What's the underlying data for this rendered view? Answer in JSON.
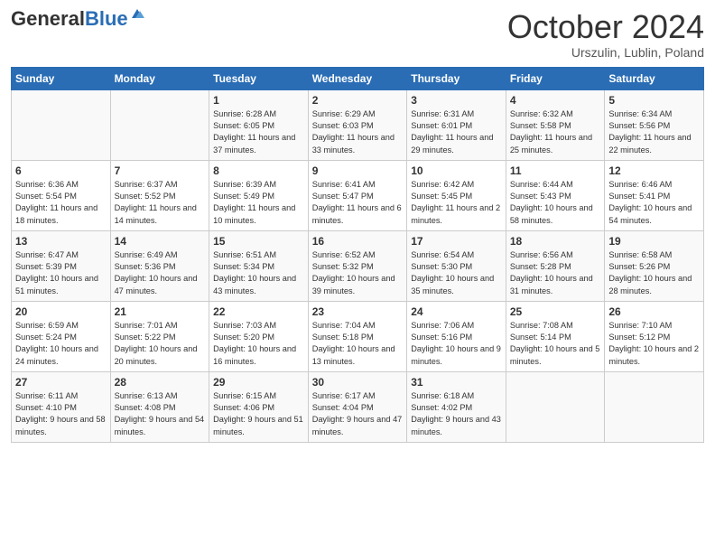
{
  "header": {
    "logo_general": "General",
    "logo_blue": "Blue",
    "month": "October 2024",
    "location": "Urszulin, Lublin, Poland"
  },
  "days_of_week": [
    "Sunday",
    "Monday",
    "Tuesday",
    "Wednesday",
    "Thursday",
    "Friday",
    "Saturday"
  ],
  "weeks": [
    [
      {
        "day": "",
        "info": ""
      },
      {
        "day": "",
        "info": ""
      },
      {
        "day": "1",
        "info": "Sunrise: 6:28 AM\nSunset: 6:05 PM\nDaylight: 11 hours and 37 minutes."
      },
      {
        "day": "2",
        "info": "Sunrise: 6:29 AM\nSunset: 6:03 PM\nDaylight: 11 hours and 33 minutes."
      },
      {
        "day": "3",
        "info": "Sunrise: 6:31 AM\nSunset: 6:01 PM\nDaylight: 11 hours and 29 minutes."
      },
      {
        "day": "4",
        "info": "Sunrise: 6:32 AM\nSunset: 5:58 PM\nDaylight: 11 hours and 25 minutes."
      },
      {
        "day": "5",
        "info": "Sunrise: 6:34 AM\nSunset: 5:56 PM\nDaylight: 11 hours and 22 minutes."
      }
    ],
    [
      {
        "day": "6",
        "info": "Sunrise: 6:36 AM\nSunset: 5:54 PM\nDaylight: 11 hours and 18 minutes."
      },
      {
        "day": "7",
        "info": "Sunrise: 6:37 AM\nSunset: 5:52 PM\nDaylight: 11 hours and 14 minutes."
      },
      {
        "day": "8",
        "info": "Sunrise: 6:39 AM\nSunset: 5:49 PM\nDaylight: 11 hours and 10 minutes."
      },
      {
        "day": "9",
        "info": "Sunrise: 6:41 AM\nSunset: 5:47 PM\nDaylight: 11 hours and 6 minutes."
      },
      {
        "day": "10",
        "info": "Sunrise: 6:42 AM\nSunset: 5:45 PM\nDaylight: 11 hours and 2 minutes."
      },
      {
        "day": "11",
        "info": "Sunrise: 6:44 AM\nSunset: 5:43 PM\nDaylight: 10 hours and 58 minutes."
      },
      {
        "day": "12",
        "info": "Sunrise: 6:46 AM\nSunset: 5:41 PM\nDaylight: 10 hours and 54 minutes."
      }
    ],
    [
      {
        "day": "13",
        "info": "Sunrise: 6:47 AM\nSunset: 5:39 PM\nDaylight: 10 hours and 51 minutes."
      },
      {
        "day": "14",
        "info": "Sunrise: 6:49 AM\nSunset: 5:36 PM\nDaylight: 10 hours and 47 minutes."
      },
      {
        "day": "15",
        "info": "Sunrise: 6:51 AM\nSunset: 5:34 PM\nDaylight: 10 hours and 43 minutes."
      },
      {
        "day": "16",
        "info": "Sunrise: 6:52 AM\nSunset: 5:32 PM\nDaylight: 10 hours and 39 minutes."
      },
      {
        "day": "17",
        "info": "Sunrise: 6:54 AM\nSunset: 5:30 PM\nDaylight: 10 hours and 35 minutes."
      },
      {
        "day": "18",
        "info": "Sunrise: 6:56 AM\nSunset: 5:28 PM\nDaylight: 10 hours and 31 minutes."
      },
      {
        "day": "19",
        "info": "Sunrise: 6:58 AM\nSunset: 5:26 PM\nDaylight: 10 hours and 28 minutes."
      }
    ],
    [
      {
        "day": "20",
        "info": "Sunrise: 6:59 AM\nSunset: 5:24 PM\nDaylight: 10 hours and 24 minutes."
      },
      {
        "day": "21",
        "info": "Sunrise: 7:01 AM\nSunset: 5:22 PM\nDaylight: 10 hours and 20 minutes."
      },
      {
        "day": "22",
        "info": "Sunrise: 7:03 AM\nSunset: 5:20 PM\nDaylight: 10 hours and 16 minutes."
      },
      {
        "day": "23",
        "info": "Sunrise: 7:04 AM\nSunset: 5:18 PM\nDaylight: 10 hours and 13 minutes."
      },
      {
        "day": "24",
        "info": "Sunrise: 7:06 AM\nSunset: 5:16 PM\nDaylight: 10 hours and 9 minutes."
      },
      {
        "day": "25",
        "info": "Sunrise: 7:08 AM\nSunset: 5:14 PM\nDaylight: 10 hours and 5 minutes."
      },
      {
        "day": "26",
        "info": "Sunrise: 7:10 AM\nSunset: 5:12 PM\nDaylight: 10 hours and 2 minutes."
      }
    ],
    [
      {
        "day": "27",
        "info": "Sunrise: 6:11 AM\nSunset: 4:10 PM\nDaylight: 9 hours and 58 minutes."
      },
      {
        "day": "28",
        "info": "Sunrise: 6:13 AM\nSunset: 4:08 PM\nDaylight: 9 hours and 54 minutes."
      },
      {
        "day": "29",
        "info": "Sunrise: 6:15 AM\nSunset: 4:06 PM\nDaylight: 9 hours and 51 minutes."
      },
      {
        "day": "30",
        "info": "Sunrise: 6:17 AM\nSunset: 4:04 PM\nDaylight: 9 hours and 47 minutes."
      },
      {
        "day": "31",
        "info": "Sunrise: 6:18 AM\nSunset: 4:02 PM\nDaylight: 9 hours and 43 minutes."
      },
      {
        "day": "",
        "info": ""
      },
      {
        "day": "",
        "info": ""
      }
    ]
  ]
}
